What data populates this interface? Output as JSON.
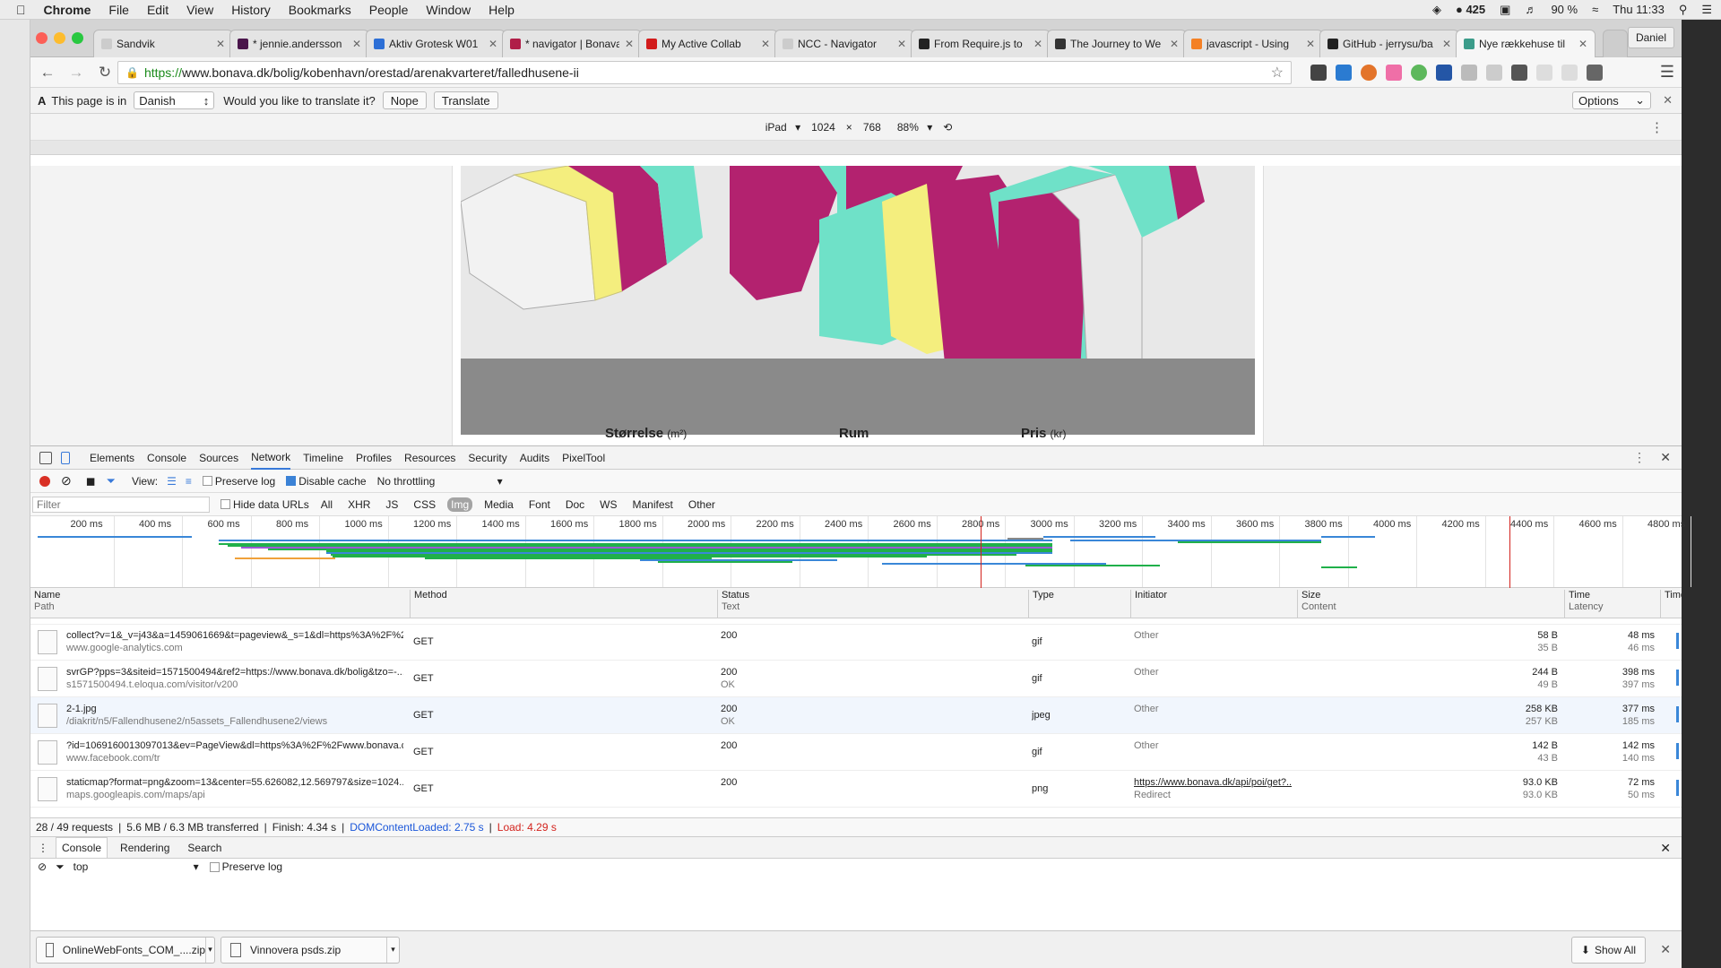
{
  "menubar": {
    "app": "Chrome",
    "items": [
      "File",
      "Edit",
      "View",
      "History",
      "Bookmarks",
      "People",
      "Window",
      "Help"
    ],
    "status": {
      "badge": "425",
      "battery": "90 %",
      "clock": "Thu 11:33"
    }
  },
  "tabs": [
    {
      "title": "Sandvik",
      "color": "#cccccc"
    },
    {
      "title": "* jennie.andersson",
      "color": "#4a154b"
    },
    {
      "title": "Aktiv Grotesk W01",
      "color": "#2d6fd6"
    },
    {
      "title": "* navigator | Bonava",
      "color": "#b01e48"
    },
    {
      "title": "My Active Collab",
      "color": "#d21b1b"
    },
    {
      "title": "NCC - Navigator",
      "color": "#cccccc"
    },
    {
      "title": "From Require.js to",
      "color": "#222222"
    },
    {
      "title": "The Journey to We",
      "color": "#333333"
    },
    {
      "title": "javascript - Using",
      "color": "#f48024"
    },
    {
      "title": "GitHub - jerrysu/ba",
      "color": "#222222"
    },
    {
      "title": "Nye rækkehuse til",
      "color": "#3b9c8a"
    }
  ],
  "profile_name": "Daniel",
  "address": {
    "scheme": "https://",
    "url": "www.bonava.dk/bolig/kobenhavn/orestad/arenakvarteret/falledhusene-ii"
  },
  "translate_bar": {
    "prefix": "This page is in",
    "language": "Danish",
    "question": "Would you like to translate it?",
    "nope": "Nope",
    "translate": "Translate",
    "options": "Options"
  },
  "device_toolbar": {
    "device": "iPad",
    "width": "1024",
    "times": "×",
    "height": "768",
    "zoom": "88%"
  },
  "page": {
    "col_size": "Størrelse",
    "col_size_unit": "(m²)",
    "col_rooms": "Rum",
    "col_price": "Pris",
    "col_price_unit": "(kr)"
  },
  "devtools": {
    "tabs": [
      "Elements",
      "Console",
      "Sources",
      "Network",
      "Timeline",
      "Profiles",
      "Resources",
      "Security",
      "Audits",
      "PixelTool"
    ],
    "active_tab": "Network",
    "controls": {
      "view": "View:",
      "preserve_log": "Preserve log",
      "disable_cache": "Disable cache",
      "throttling": "No throttling"
    },
    "filter": {
      "placeholder": "Filter",
      "hide_data_urls": "Hide data URLs",
      "types": [
        "All",
        "XHR",
        "JS",
        "CSS",
        "Img",
        "Media",
        "Font",
        "Doc",
        "WS",
        "Manifest",
        "Other"
      ],
      "active_type": "Img"
    },
    "timeline_ticks": [
      "200 ms",
      "400 ms",
      "600 ms",
      "800 ms",
      "1000 ms",
      "1200 ms",
      "1400 ms",
      "1600 ms",
      "1800 ms",
      "2000 ms",
      "2200 ms",
      "2400 ms",
      "2600 ms",
      "2800 ms",
      "3000 ms",
      "3200 ms",
      "3400 ms",
      "3600 ms",
      "3800 ms",
      "4000 ms",
      "4200 ms",
      "4400 ms",
      "4600 ms",
      "4800 ms"
    ],
    "columns": {
      "name": "Name",
      "name_sub": "Path",
      "method": "Method",
      "status": "Status",
      "status_sub": "Text",
      "type": "Type",
      "initiator": "Initiator",
      "size": "Size",
      "size_sub": "Content",
      "time": "Time",
      "time_sub": "Latency",
      "timeline": "Timeline"
    },
    "requests": [
      {
        "name": "collect?v=1&_v=j43&a=1459061669&t=pageview&_s=1&dl=https%3A%2F%2...",
        "path": "www.google-analytics.com",
        "method": "GET",
        "status": "200",
        "status_text": "",
        "type": "gif",
        "initiator": "Other",
        "initiator_sub": "",
        "size": "58 B",
        "content": "35 B",
        "time": "48 ms",
        "latency": "46 ms"
      },
      {
        "name": "svrGP?pps=3&siteid=1571500494&ref2=https://www.bonava.dk/bolig&tzo=-...",
        "path": "s1571500494.t.eloqua.com/visitor/v200",
        "method": "GET",
        "status": "200",
        "status_text": "OK",
        "type": "gif",
        "initiator": "Other",
        "initiator_sub": "",
        "size": "244 B",
        "content": "49 B",
        "time": "398 ms",
        "latency": "397 ms"
      },
      {
        "name": "2-1.jpg",
        "path": "/diakrit/n5/Fallendhusene2/n5assets_Fallendhusene2/views",
        "method": "GET",
        "status": "200",
        "status_text": "OK",
        "type": "jpeg",
        "initiator": "Other",
        "initiator_sub": "",
        "size": "258 KB",
        "content": "257 KB",
        "time": "377 ms",
        "latency": "185 ms"
      },
      {
        "name": "?id=1069160013097013&ev=PageView&dl=https%3A%2F%2Fwww.bonava.d...",
        "path": "www.facebook.com/tr",
        "method": "GET",
        "status": "200",
        "status_text": "",
        "type": "gif",
        "initiator": "Other",
        "initiator_sub": "",
        "size": "142 B",
        "content": "43 B",
        "time": "142 ms",
        "latency": "140 ms"
      },
      {
        "name": "staticmap?format=png&zoom=13&center=55.626082,12.569797&size=1024...",
        "path": "maps.googleapis.com/maps/api",
        "method": "GET",
        "status": "200",
        "status_text": "",
        "type": "png",
        "initiator": "https://www.bonava.dk/api/poi/get?...",
        "initiator_sub": "Redirect",
        "size": "93.0 KB",
        "content": "93.0 KB",
        "time": "72 ms",
        "latency": "50 ms"
      }
    ],
    "summary": {
      "requests": "28 / 49 requests",
      "transferred": "5.6 MB / 6.3 MB transferred",
      "finish": "Finish: 4.34 s",
      "dcl": "DOMContentLoaded: 2.75 s",
      "load": "Load: 4.29 s"
    },
    "drawer": {
      "tabs": [
        "Console",
        "Rendering",
        "Search"
      ],
      "active": "Console",
      "context": "top",
      "preserve_log": "Preserve log"
    }
  },
  "downloads": {
    "items": [
      "OnlineWebFonts_COM_....zip",
      "Vinnovera psds.zip"
    ],
    "show_all": "Show All"
  },
  "colors": {
    "magenta": "#b3226f",
    "teal": "#6fe1c8",
    "yellow": "#f4ee7e",
    "accent": "#3879d9"
  }
}
